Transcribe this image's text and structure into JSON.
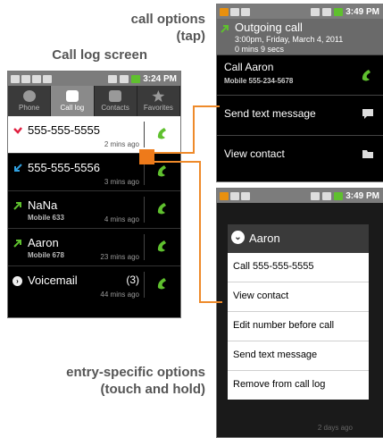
{
  "captions": {
    "call_options": "call options",
    "call_options_tap": "(tap)",
    "call_log_screen": "Call log screen",
    "entry_specific": "entry-specific options",
    "entry_specific_hold": "(touch and hold)"
  },
  "call_log_phone": {
    "status_time": "3:24 PM",
    "tabs": [
      "Phone",
      "Call log",
      "Contacts",
      "Favorites"
    ],
    "rows": [
      {
        "name": "555-555-5555",
        "sub": "",
        "time": "2 mins ago",
        "type": "missed"
      },
      {
        "name": "555-555-5556",
        "sub": "",
        "time": "3 mins ago",
        "type": "incoming"
      },
      {
        "name": "NaNa",
        "sub": "Mobile 633",
        "time": "4 mins ago",
        "type": "outgoing"
      },
      {
        "name": "Aaron",
        "sub": "Mobile 678",
        "time": "23 mins ago",
        "type": "outgoing"
      },
      {
        "name": "Voicemail",
        "sub": "",
        "count": "(3)",
        "time": "44 mins ago",
        "type": "voicemail"
      }
    ]
  },
  "call_options_phone": {
    "status_time": "3:49 PM",
    "header": {
      "title": "Outgoing call",
      "line1": "3:00pm, Friday, March 4, 2011",
      "line2": "0 mins 9 secs"
    },
    "items": [
      {
        "label": "Call Aaron",
        "sub": "Mobile 555-234-5678"
      },
      {
        "label": "Send text message",
        "sub": ""
      },
      {
        "label": "View contact",
        "sub": ""
      }
    ]
  },
  "entry_options_phone": {
    "status_time": "3:49 PM",
    "menu_title": "Aaron",
    "menu_items": [
      "Call 555-555-5555",
      "View contact",
      "Edit number before call",
      "Send text message",
      "Remove from call log"
    ],
    "bottom_time": "2 days ago"
  },
  "colors": {
    "accent_orange": "#ee8a2a",
    "call_green": "#5fc02e",
    "missed_red": "#e02040",
    "incoming_blue": "#30a0e0"
  }
}
